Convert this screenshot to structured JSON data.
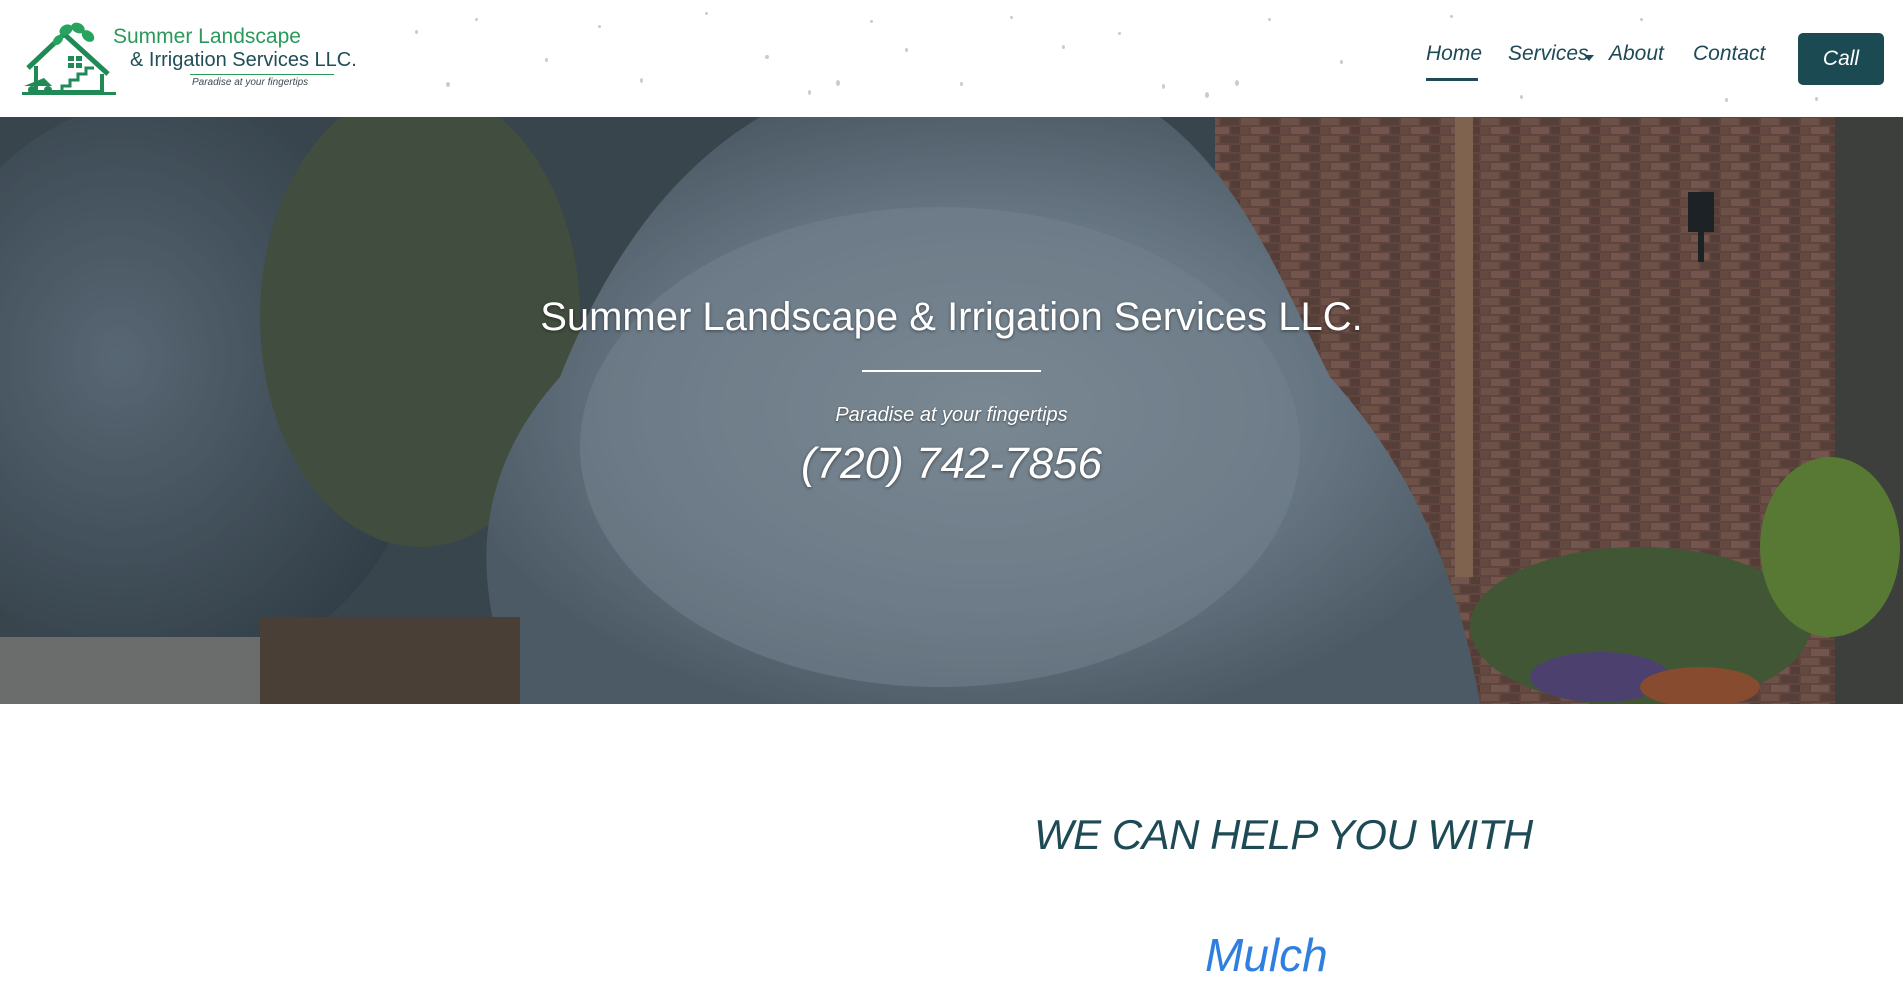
{
  "logo": {
    "line1": "Summer Landscape",
    "line2": "& Irrigation Services LLC.",
    "tagline": "Paradise at your fingertips"
  },
  "nav": {
    "items": [
      "Home",
      "Services",
      "About",
      "Contact"
    ],
    "active": "Home",
    "call_label": "Call"
  },
  "hero": {
    "title": "Summer Landscape & Irrigation Services LLC.",
    "tagline": "Paradise at your fingertips",
    "phone": "(720) 742-7856"
  },
  "section": {
    "heading": "WE CAN HELP YOU WITH",
    "first_item_partial": "Mulch"
  },
  "colors": {
    "brand_dark": "#1b4a52",
    "brand_green": "#2a9a5b",
    "link_blue": "#2f7fe0"
  },
  "icons": [
    "house-leaf-logo-icon",
    "caret-down-icon"
  ]
}
